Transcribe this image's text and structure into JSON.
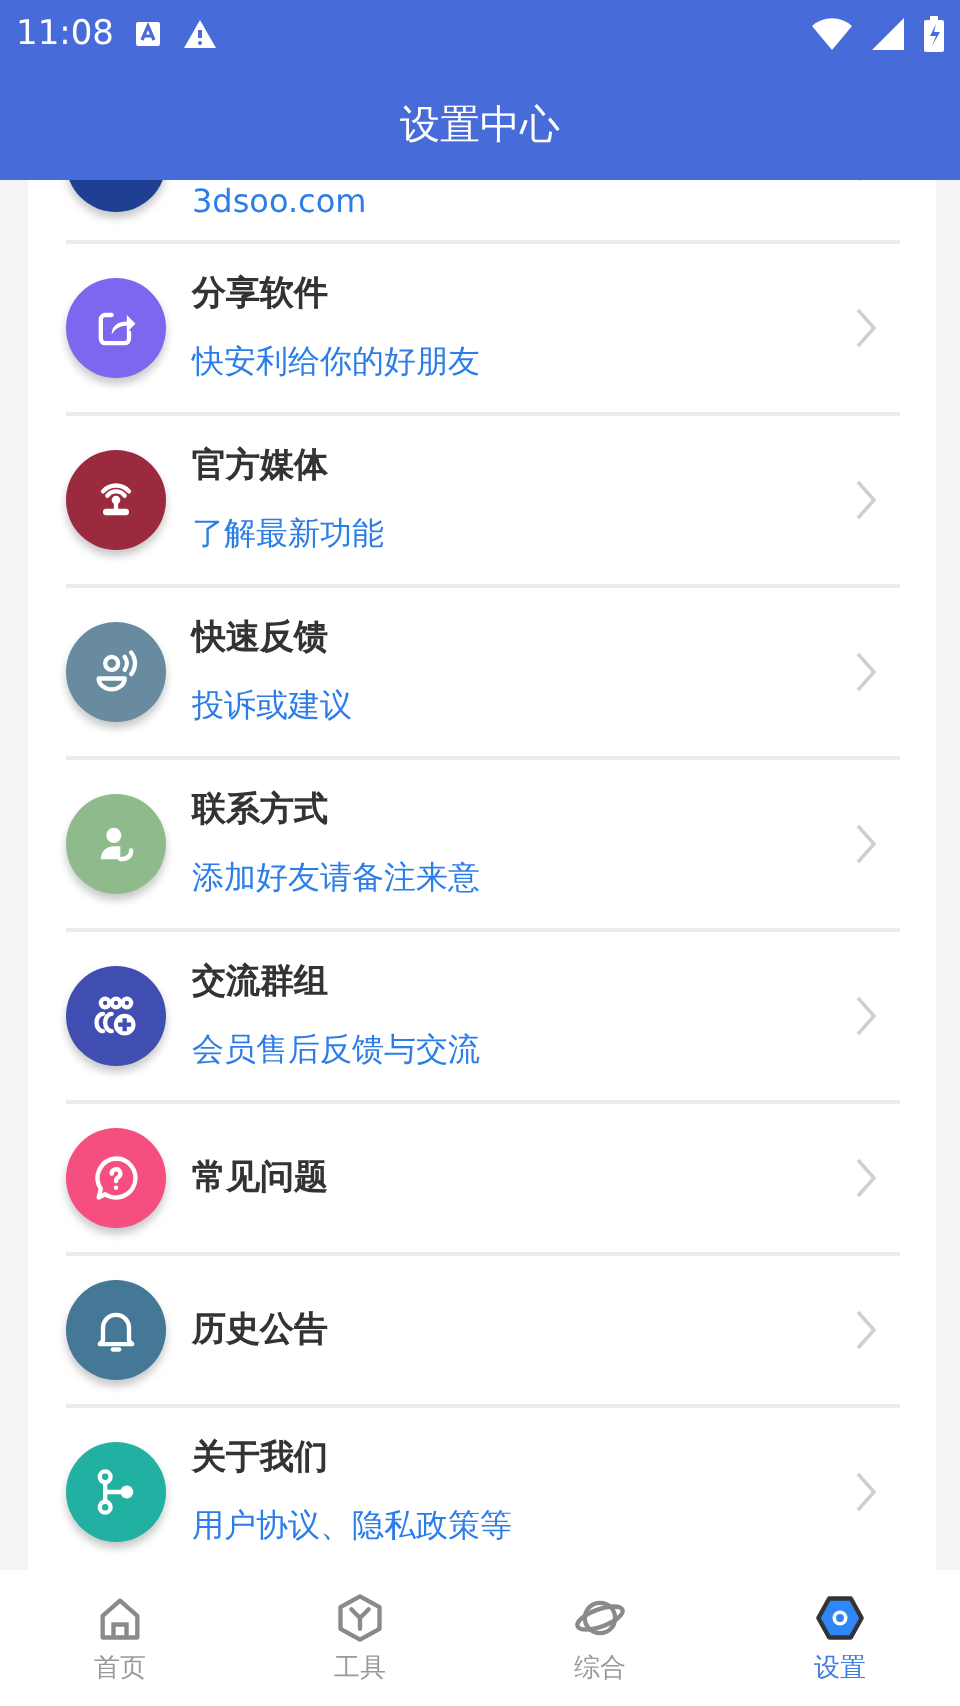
{
  "status_bar": {
    "time": "11:08"
  },
  "header": {
    "title": "设置中心"
  },
  "items": [
    {
      "subtitle": "3dsoo.com",
      "color": "#1f3f94"
    },
    {
      "title": "分享软件",
      "subtitle": "快安利给你的好朋友",
      "color": "#7b68ee"
    },
    {
      "title": "官方媒体",
      "subtitle": "了解最新功能",
      "color": "#9b2a3e"
    },
    {
      "title": "快速反馈",
      "subtitle": "投诉或建议",
      "color": "#688ba0"
    },
    {
      "title": "联系方式",
      "subtitle": "添加好友请备注来意",
      "color": "#8fbb8c"
    },
    {
      "title": "交流群组",
      "subtitle": "会员售后反馈与交流",
      "color": "#3f4eb0"
    },
    {
      "title": "常见问题",
      "color": "#f44f7f"
    },
    {
      "title": "历史公告",
      "color": "#457797"
    },
    {
      "title": "关于我们",
      "subtitle": "用户协议、隐私政策等",
      "color": "#22b0a2"
    }
  ],
  "tabs": [
    {
      "label": "首页",
      "selected": false
    },
    {
      "label": "工具",
      "selected": false
    },
    {
      "label": "综合",
      "selected": false
    },
    {
      "label": "设置",
      "selected": true
    }
  ]
}
